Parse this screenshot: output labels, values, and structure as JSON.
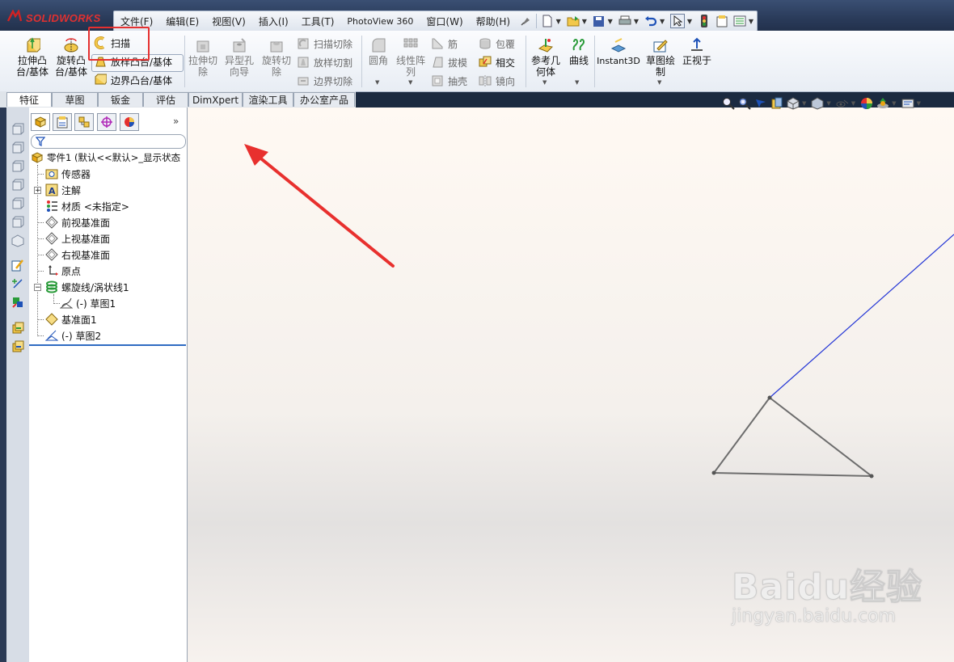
{
  "app": {
    "logo_text": "SOLIDWORKS",
    "logo_prefix": "DS"
  },
  "menu": {
    "items": [
      "文件(F)",
      "编辑(E)",
      "视图(V)",
      "插入(I)",
      "工具(T)",
      "PhotoView 360",
      "窗口(W)",
      "帮助(H)"
    ]
  },
  "ribbon": {
    "extrude_boss": "拉伸凸\n台/基体",
    "revolve_boss": "旋转凸\n台/基体",
    "sweep": "扫描",
    "lofted_boss": "放样凸台/基体",
    "boundary_boss": "边界凸台/基体",
    "extrude_cut": "拉伸切\n除",
    "hole_wizard": "异型孔\n向导",
    "revolve_cut": "旋转切\n除",
    "swept_cut": "扫描切除",
    "lofted_cut": "放样切割",
    "boundary_cut": "边界切除",
    "fillet": "圆角",
    "linear_pattern": "线性阵\n列",
    "rib": "筋",
    "draft": "拔模",
    "shell": "抽壳",
    "wrap": "包覆",
    "intersect": "相交",
    "mirror": "镜向",
    "ref_geometry": "参考几\n何体",
    "curves": "曲线",
    "instant3d": "Instant3D",
    "sketch": "草图绘\n制",
    "normal_to": "正视于"
  },
  "tabs": [
    "特征",
    "草图",
    "钣金",
    "评估",
    "DimXpert",
    "渲染工具",
    "办公室产品"
  ],
  "active_tab": "特征",
  "tree": {
    "root": "零件1  (默认<<默认>_显示状态",
    "items": [
      {
        "label": "传感器",
        "icon": "sensor-icon"
      },
      {
        "label": "注解",
        "icon": "annotation-icon"
      },
      {
        "label": "材质 <未指定>",
        "icon": "material-icon"
      },
      {
        "label": "前视基准面",
        "icon": "plane-icon"
      },
      {
        "label": "上视基准面",
        "icon": "plane-icon"
      },
      {
        "label": "右视基准面",
        "icon": "plane-icon"
      },
      {
        "label": "原点",
        "icon": "origin-icon"
      },
      {
        "label": "螺旋线/涡状线1",
        "icon": "helix-icon"
      },
      {
        "label": "(-) 草图1",
        "icon": "sketch-icon"
      },
      {
        "label": "基准面1",
        "icon": "plane-icon"
      },
      {
        "label": "(-) 草图2",
        "icon": "sketch-icon"
      }
    ]
  },
  "watermark": {
    "main": "Baidu经验",
    "sub": "jingyan.baidu.com"
  },
  "colors": {
    "highlight": "#e53030",
    "arrow": "#e8302e",
    "helix_line": "#2436d6",
    "sketch": "#6d6d6d"
  }
}
